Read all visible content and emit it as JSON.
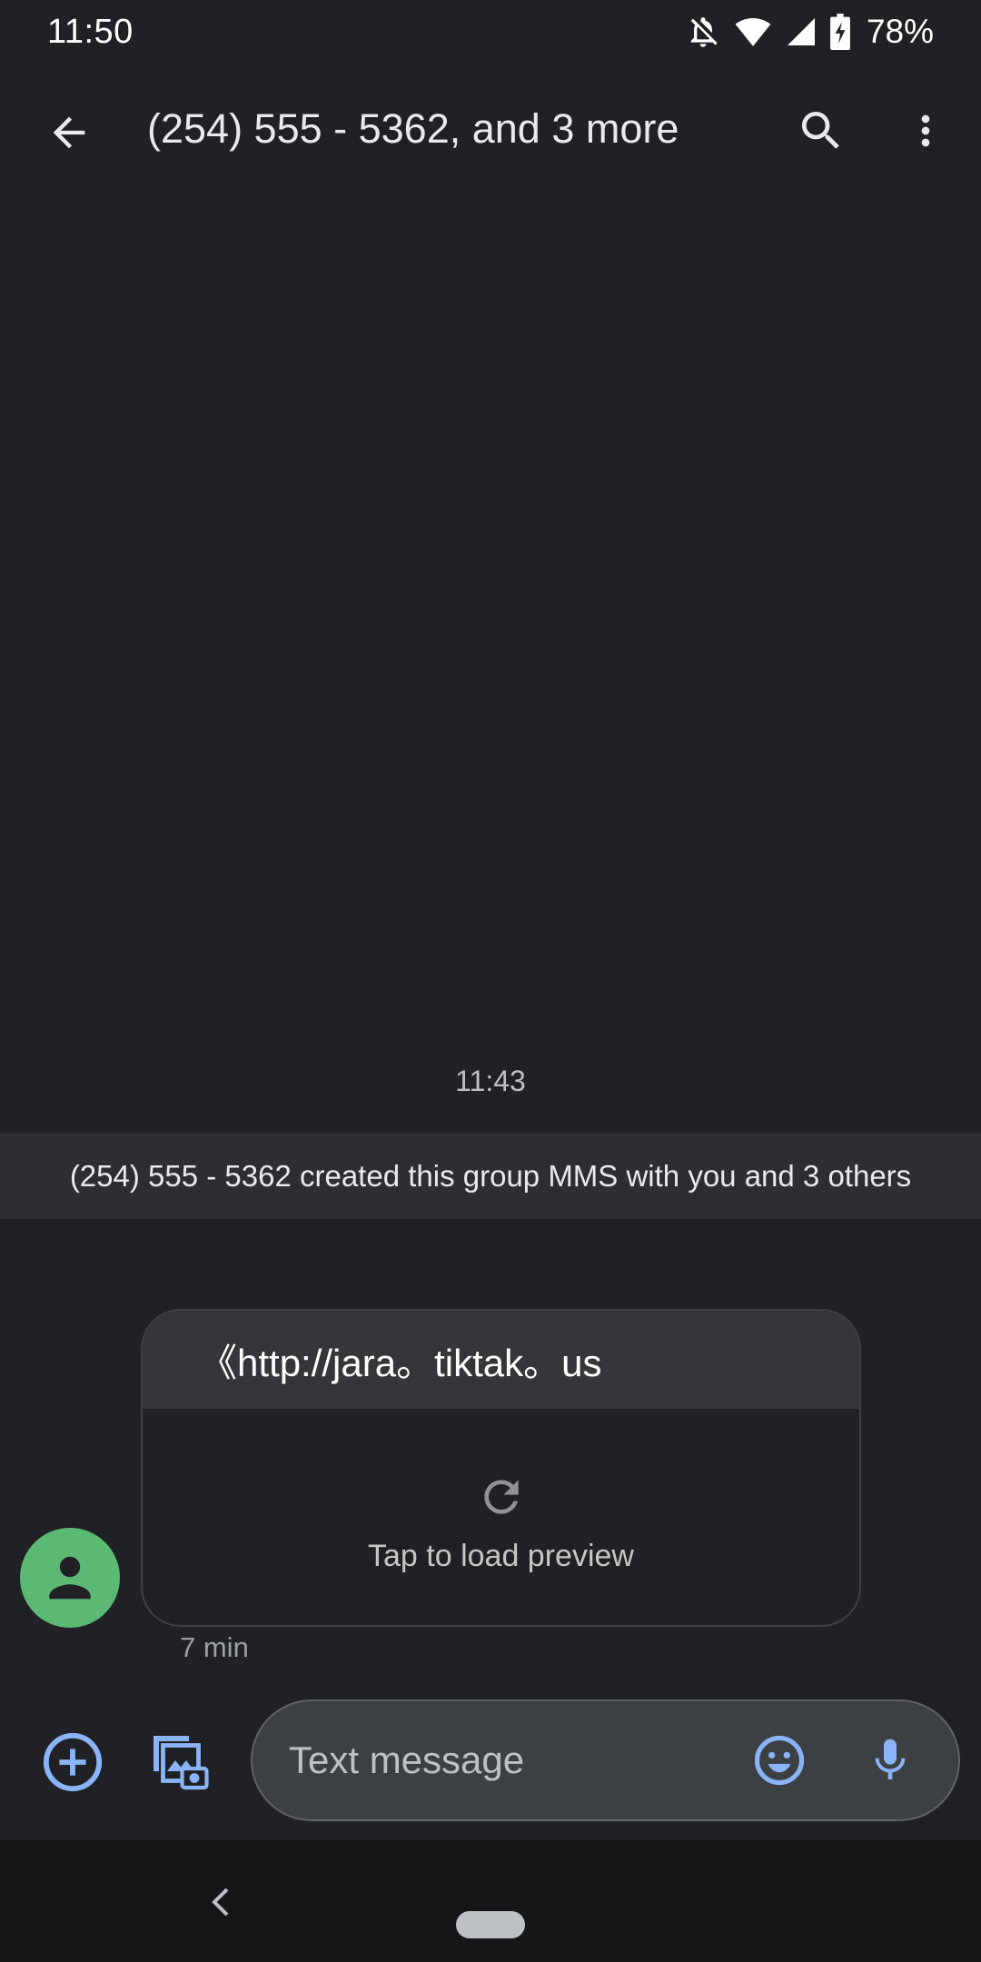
{
  "status_bar": {
    "time": "11:50",
    "battery": "78%",
    "icons": [
      "notifications-off-icon",
      "wifi-icon",
      "signal-icon",
      "battery-charging-icon"
    ]
  },
  "app_bar": {
    "title": "(254) 555 - 5362, and 3 more",
    "back_icon": "arrow-back-icon",
    "search_icon": "search-icon",
    "more_icon": "more-vert-icon"
  },
  "conversation": {
    "timestamp": "11:43",
    "system_message": "(254) 555 - 5362 created this group MMS with you and 3 others",
    "message": {
      "link_text": "《http://jara。tiktak。us",
      "preview_label": "Tap to load preview",
      "time": "7 min",
      "avatar_color": "#5bb974"
    }
  },
  "compose": {
    "placeholder": "Text message",
    "value": "",
    "accent_color": "#8ab4f8"
  },
  "nav_bar": {
    "back_icon": "nav-back-icon",
    "home_icon": "home-pill-icon"
  }
}
